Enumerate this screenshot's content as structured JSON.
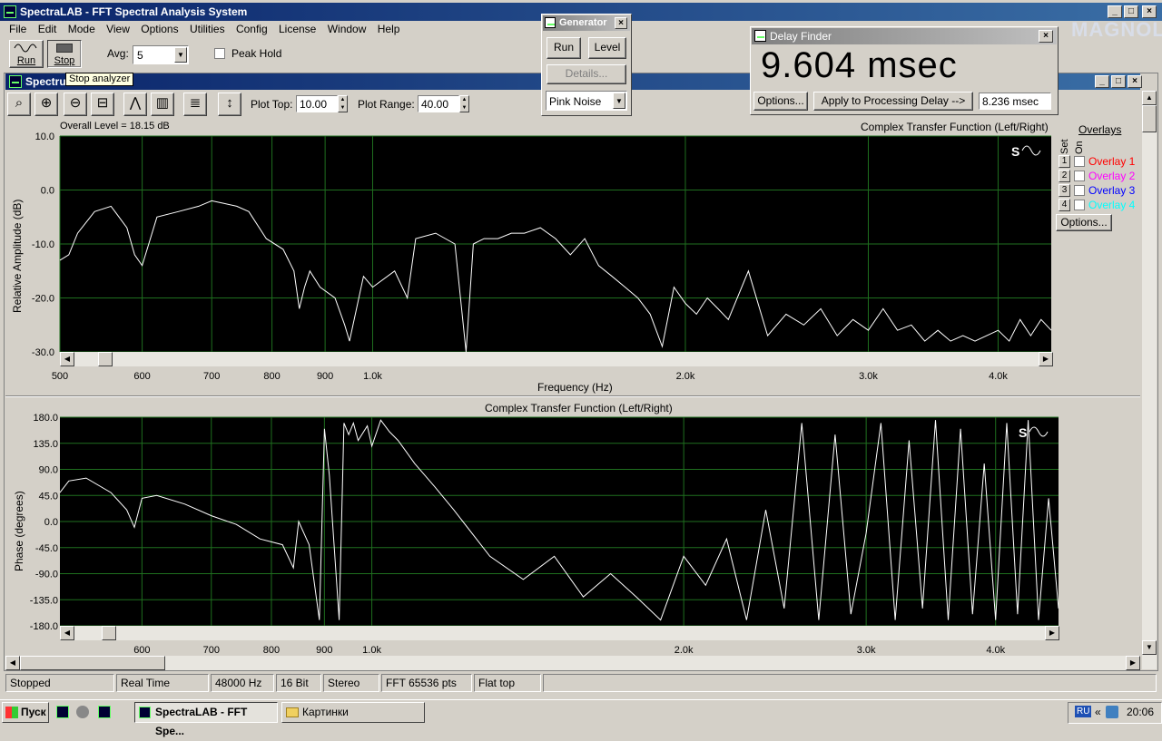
{
  "app": {
    "title": "SpectraLAB - FFT Spectral Analysis System",
    "menu": [
      "File",
      "Edit",
      "Mode",
      "View",
      "Options",
      "Utilities",
      "Config",
      "License",
      "Window",
      "Help"
    ],
    "run_label": "Run",
    "stop_label": "Stop",
    "avg_label": "Avg:",
    "avg_value": "5",
    "peak_hold_label": "Peak Hold",
    "tooltip": "Stop analyzer",
    "logo": "MAGNOLIA"
  },
  "spectrum_window": {
    "title": "Spectru",
    "plot_top_label": "Plot Top:",
    "plot_top_value": "10.00",
    "plot_range_label": "Plot Range:",
    "plot_range_value": "40.00",
    "toolbar_icons": [
      "zoom-icon",
      "zoom-in-2x-icon",
      "zoom-out-2x-icon",
      "zoom-out-full-icon",
      "peak-icon",
      "bars-icon",
      "list-icon",
      "vertical-scale-icon"
    ]
  },
  "generator": {
    "title": "Generator",
    "run_label": "Run",
    "level_label": "Level",
    "details_label": "Details...",
    "signal_value": "Pink Noise"
  },
  "delay_finder": {
    "title": "Delay Finder",
    "value": "9.604 msec",
    "options_label": "Options...",
    "apply_label": "Apply to Processing Delay -->",
    "delay_field": "8.236 msec"
  },
  "overlays": {
    "title": "Overlays",
    "set_label": "Set",
    "on_label": "On",
    "items": [
      {
        "num": "1",
        "label": "Overlay 1",
        "color": "#ff0000"
      },
      {
        "num": "2",
        "label": "Overlay 2",
        "color": "#ff00ff"
      },
      {
        "num": "3",
        "label": "Overlay 3",
        "color": "#0000ff"
      },
      {
        "num": "4",
        "label": "Overlay 4",
        "color": "#00ffff"
      }
    ],
    "options_label": "Options..."
  },
  "chart_data": [
    {
      "type": "line",
      "title": "Complex Transfer Function (Left/Right)",
      "annotation": "Overall Level = 18.15 dB",
      "xlabel": "Frequency (Hz)",
      "ylabel": "Relative Amplitude (dB)",
      "ylim": [
        -30,
        10
      ],
      "xlim": [
        500,
        4500
      ],
      "x_scale": "log",
      "grid": true,
      "y_ticks": [
        "10.0",
        "0.0",
        "-10.0",
        "-20.0",
        "-30.0"
      ],
      "x_ticks": [
        {
          "v": 500,
          "label": "500"
        },
        {
          "v": 600,
          "label": "600"
        },
        {
          "v": 700,
          "label": "700"
        },
        {
          "v": 800,
          "label": "800"
        },
        {
          "v": 900,
          "label": "900"
        },
        {
          "v": 1000,
          "label": "1.0k"
        },
        {
          "v": 2000,
          "label": "2.0k"
        },
        {
          "v": 3000,
          "label": "3.0k"
        },
        {
          "v": 4000,
          "label": "4.0k"
        }
      ],
      "series": [
        {
          "color": "#ffffff",
          "x": [
            500,
            510,
            520,
            540,
            560,
            580,
            590,
            600,
            620,
            650,
            680,
            700,
            720,
            740,
            760,
            790,
            820,
            840,
            850,
            860,
            870,
            890,
            920,
            940,
            950,
            980,
            1000,
            1050,
            1080,
            1100,
            1150,
            1200,
            1230,
            1250,
            1280,
            1320,
            1360,
            1400,
            1450,
            1500,
            1550,
            1600,
            1650,
            1700,
            1750,
            1800,
            1850,
            1900,
            1950,
            2000,
            2050,
            2100,
            2150,
            2200,
            2300,
            2400,
            2500,
            2600,
            2700,
            2800,
            2900,
            3000,
            3100,
            3200,
            3300,
            3400,
            3500,
            3600,
            3700,
            3800,
            3900,
            4000,
            4100,
            4200,
            4300,
            4400,
            4500
          ],
          "y": [
            -13,
            -12,
            -8,
            -4,
            -3,
            -7,
            -12,
            -14,
            -5,
            -4,
            -3,
            -2,
            -2.5,
            -3,
            -4,
            -9,
            -11,
            -15,
            -22,
            -18,
            -15,
            -18,
            -20,
            -25,
            -28,
            -16,
            -18,
            -15,
            -20,
            -9,
            -8,
            -10,
            -30,
            -10,
            -9,
            -9,
            -8,
            -8,
            -7,
            -9,
            -12,
            -9,
            -14,
            -16,
            -18,
            -20,
            -23,
            -29,
            -18,
            -21,
            -23,
            -20,
            -22,
            -24,
            -15,
            -27,
            -23,
            -25,
            -22,
            -27,
            -24,
            -26,
            -22,
            -26,
            -25,
            -28,
            -26,
            -28,
            -27,
            -28,
            -27,
            -26,
            -28,
            -24,
            -27,
            -24,
            -26
          ]
        }
      ]
    },
    {
      "type": "line",
      "title": "Complex Transfer Function (Left/Right)",
      "xlabel": "",
      "ylabel": "Phase (degrees)",
      "ylim": [
        -180,
        180
      ],
      "xlim": [
        500,
        4600
      ],
      "x_scale": "log",
      "grid": true,
      "y_ticks": [
        "180.0",
        "135.0",
        "90.0",
        "45.0",
        "0.0",
        "-45.0",
        "-90.0",
        "-135.0",
        "-180.0"
      ],
      "x_ticks": [
        {
          "v": 600,
          "label": "600"
        },
        {
          "v": 700,
          "label": "700"
        },
        {
          "v": 800,
          "label": "800"
        },
        {
          "v": 900,
          "label": "900"
        },
        {
          "v": 1000,
          "label": "1.0k"
        },
        {
          "v": 2000,
          "label": "2.0k"
        },
        {
          "v": 3000,
          "label": "3.0k"
        },
        {
          "v": 4000,
          "label": "4.0k"
        }
      ],
      "series": [
        {
          "color": "#ffffff",
          "x": [
            500,
            510,
            530,
            560,
            580,
            590,
            600,
            620,
            660,
            700,
            740,
            780,
            820,
            840,
            850,
            870,
            890,
            900,
            910,
            930,
            940,
            950,
            960,
            970,
            990,
            1000,
            1020,
            1040,
            1060,
            1080,
            1100,
            1150,
            1200,
            1300,
            1400,
            1500,
            1600,
            1700,
            1800,
            1900,
            2000,
            2100,
            2200,
            2300,
            2400,
            2500,
            2600,
            2700,
            2800,
            2900,
            3000,
            3100,
            3200,
            3300,
            3400,
            3500,
            3600,
            3700,
            3800,
            3900,
            4000,
            4100,
            4200,
            4300,
            4400,
            4500,
            4600
          ],
          "y": [
            50,
            70,
            75,
            50,
            20,
            -10,
            40,
            45,
            30,
            10,
            -5,
            -30,
            -40,
            -80,
            0,
            -40,
            -170,
            160,
            80,
            -170,
            170,
            150,
            170,
            140,
            165,
            130,
            175,
            155,
            140,
            120,
            100,
            60,
            20,
            -60,
            -100,
            -60,
            -130,
            -90,
            -130,
            -170,
            -60,
            -110,
            -30,
            -170,
            20,
            -150,
            170,
            -170,
            150,
            -160,
            -20,
            170,
            -170,
            140,
            -150,
            175,
            -170,
            160,
            -160,
            100,
            -170,
            170,
            -160,
            175,
            -170,
            40,
            -150
          ]
        }
      ]
    }
  ],
  "status": [
    "Stopped",
    "Real Time",
    "48000 Hz",
    "16 Bit",
    "Stereo",
    "FFT 65536 pts",
    "Flat top"
  ],
  "taskbar": {
    "start_label": "Пуск",
    "task1": "SpectraLAB - FFT Spe...",
    "task2": "Картинки",
    "lang": "RU",
    "clock": "20:06"
  }
}
